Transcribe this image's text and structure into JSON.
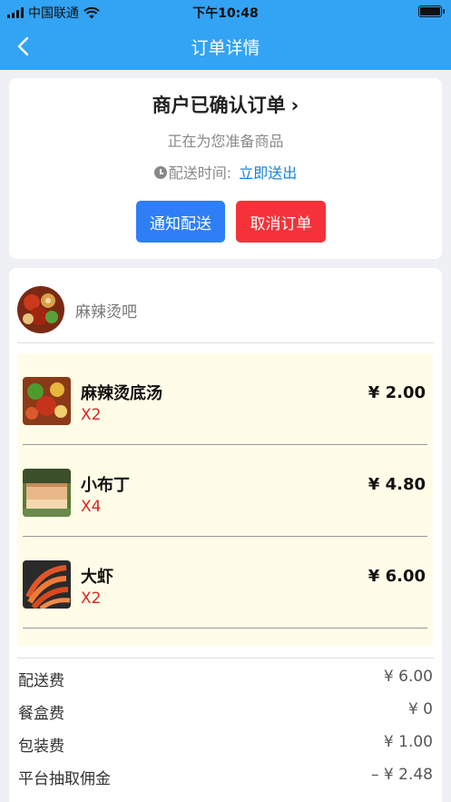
{
  "status_bar": {
    "carrier": "中国联通",
    "time": "下午10:48"
  },
  "nav": {
    "title": "订单详情"
  },
  "order_status": {
    "title": "商户已确认订单",
    "subtitle": "正在为您准备商品",
    "delivery_label": "配送时间:",
    "delivery_value": "立即送出",
    "notify_button": "通知配送",
    "cancel_button": "取消订单"
  },
  "shop": {
    "name": "麻辣烫吧"
  },
  "items": [
    {
      "name": "麻辣烫底汤",
      "qty": "X2",
      "price": "¥ 2.00"
    },
    {
      "name": "小布丁",
      "qty": "X4",
      "price": "¥ 4.80"
    },
    {
      "name": "大虾",
      "qty": "X2",
      "price": "¥ 6.00"
    }
  ],
  "fees": [
    {
      "label": "配送费",
      "amount": "¥ 6.00"
    },
    {
      "label": "餐盒费",
      "amount": "¥ 0"
    },
    {
      "label": "包装费",
      "amount": "¥ 1.00"
    },
    {
      "label": "平台抽取佣金",
      "amount": "– ¥ 2.48"
    }
  ],
  "colors": {
    "header": "#33a3f4",
    "notify": "#2d7ef7",
    "cancel": "#f5323a",
    "qty": "#e12222",
    "link": "#1a7fd6"
  }
}
